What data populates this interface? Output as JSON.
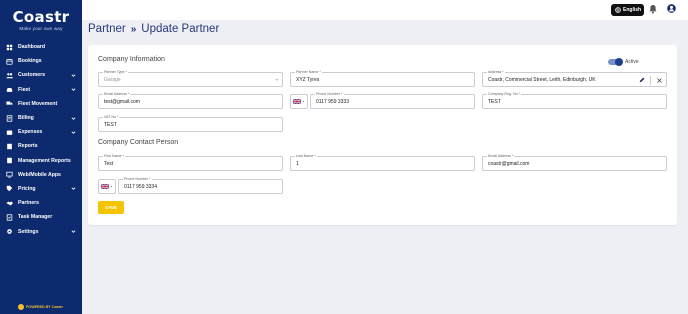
{
  "brand": {
    "name": "Coastr",
    "tagline": "Make your own way",
    "powered_by": "POWERED BY Coastr",
    "accent": "#f5c400",
    "sidebar_bg": "#0d2a6e"
  },
  "sidebar": {
    "items": [
      {
        "label": "Dashboard",
        "icon": "dashboard-icon",
        "has_children": false
      },
      {
        "label": "Bookings",
        "icon": "bookings-icon",
        "has_children": false
      },
      {
        "label": "Customers",
        "icon": "customers-icon",
        "has_children": true
      },
      {
        "label": "Fleet",
        "icon": "car-icon",
        "has_children": true
      },
      {
        "label": "Fleet Movement",
        "icon": "truck-icon",
        "has_children": false
      },
      {
        "label": "Billing",
        "icon": "billing-icon",
        "has_children": true
      },
      {
        "label": "Expenses",
        "icon": "wallet-icon",
        "has_children": true
      },
      {
        "label": "Reports",
        "icon": "reports-icon",
        "has_children": false
      },
      {
        "label": "Management Reports",
        "icon": "management-reports-icon",
        "has_children": false
      },
      {
        "label": "Web/Mobile Apps",
        "icon": "apps-icon",
        "has_children": false
      },
      {
        "label": "Pricing",
        "icon": "tag-icon",
        "has_children": true
      },
      {
        "label": "Partners",
        "icon": "handshake-icon",
        "has_children": false
      },
      {
        "label": "Task Manager",
        "icon": "task-icon",
        "has_children": false
      },
      {
        "label": "Settings",
        "icon": "gear-icon",
        "has_children": true
      }
    ]
  },
  "topbar": {
    "language": "English"
  },
  "page": {
    "breadcrumb_parent": "Partner",
    "breadcrumb_sep": "»",
    "title": "Update Partner"
  },
  "company": {
    "section_title": "Company Information",
    "active_label": "Active",
    "active": true,
    "partner_type": {
      "label": "Partner Type *",
      "value": "Garage"
    },
    "partner_name": {
      "label": "Partner Name *",
      "value": "XYZ Tyres"
    },
    "address": {
      "label": "Address *",
      "value": "Coastr, Commercial Street, Leith, Edinburgh, UK"
    },
    "email": {
      "label": "Email Address *",
      "value": "test@gmail.com"
    },
    "phone": {
      "label": "Phone Number *",
      "value": "0117 959 3333",
      "country": "GB"
    },
    "reg_no": {
      "label": "Company Reg. No *",
      "value": "TEST"
    },
    "vat_no": {
      "label": "VAT No *",
      "value": "TEST"
    }
  },
  "contact": {
    "section_title": "Company Contact Person",
    "first_name": {
      "label": "First Name *",
      "value": "Test"
    },
    "last_name": {
      "label": "Last Name *",
      "value": "1"
    },
    "email": {
      "label": "Email Address *",
      "value": "coastr@gmail.com"
    },
    "phone": {
      "label": "Phone Number *",
      "value": "0117 959 3334",
      "country": "GB"
    }
  },
  "actions": {
    "save_label": "SAVE"
  }
}
